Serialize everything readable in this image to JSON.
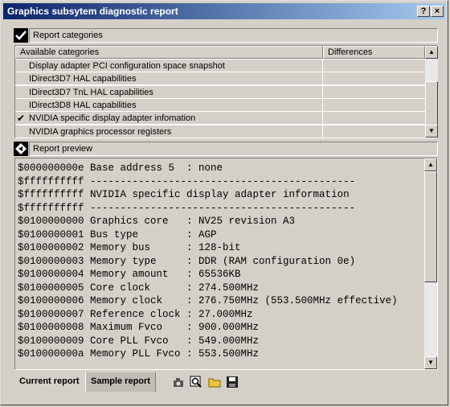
{
  "window": {
    "title": "Graphics subsytem diagnostic report",
    "help_btn": "?",
    "close_btn": "×"
  },
  "categories": {
    "header": "Report categories",
    "columns": [
      "Available categories",
      "Differences"
    ],
    "items": [
      {
        "label": "Display adapter PCI configuration space snapshot",
        "checked": false
      },
      {
        "label": "IDirect3D7 HAL capabilities",
        "checked": false
      },
      {
        "label": "IDirect3D7 TnL HAL capabilities",
        "checked": false
      },
      {
        "label": "IDirect3D8 HAL capabilities",
        "checked": false
      },
      {
        "label": "NVIDIA specific display adapter infomation",
        "checked": true
      },
      {
        "label": "NVIDIA graphics processor registers",
        "checked": false
      }
    ]
  },
  "preview": {
    "header": "Report preview",
    "lines": [
      "$000000000e Base address 5  : none",
      "$ffffffffff --------------------------------------------",
      "$ffffffffff NVIDIA specific display adapter information",
      "$ffffffffff --------------------------------------------",
      "$0100000000 Graphics core   : NV25 revision A3",
      "$0100000001 Bus type        : AGP",
      "$0100000002 Memory bus      : 128-bit",
      "$0100000003 Memory type     : DDR (RAM configuration 0e)",
      "$0100000004 Memory amount   : 65536KB",
      "$0100000005 Core clock      : 274.500MHz",
      "$0100000006 Memory clock    : 276.750MHz (553.500MHz effective)",
      "$0100000007 Reference clock : 27.000MHz",
      "$0100000008 Maximum Fvco    : 900.000MHz",
      "$0100000009 Core PLL Fvco   : 549.000MHz",
      "$010000000a Memory PLL Fvco : 553.500MHz"
    ]
  },
  "tabs": [
    {
      "label": "Current report",
      "active": true
    },
    {
      "label": "Sample report",
      "active": false
    }
  ],
  "toolbar": [
    "camera-icon",
    "zoom-icon",
    "open-folder-icon",
    "save-disk-icon"
  ]
}
